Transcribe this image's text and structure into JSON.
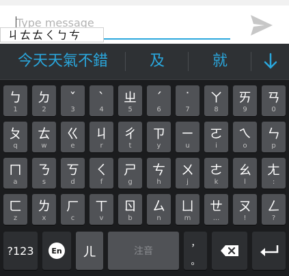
{
  "compose": {
    "placeholder": "Type message",
    "composing_text": "ㄐㄊㄊㄑㄅㄘ",
    "send_icon": "send-icon"
  },
  "candidates": {
    "items": [
      "今天天氣不錯",
      "及",
      "就"
    ],
    "more_icon": "chevron-down-icon"
  },
  "keyboard": {
    "rows": [
      [
        {
          "main": "ㄅ",
          "sub": "1"
        },
        {
          "main": "ㄉ",
          "sub": "2"
        },
        {
          "main": "ˇ",
          "sub": "3"
        },
        {
          "main": "ˋ",
          "sub": "4"
        },
        {
          "main": "ㄓ",
          "sub": "5"
        },
        {
          "main": "ˊ",
          "sub": "6"
        },
        {
          "main": "˙",
          "sub": "7"
        },
        {
          "main": "ㄚ",
          "sub": "8"
        },
        {
          "main": "ㄞ",
          "sub": "9"
        },
        {
          "main": "ㄢ",
          "sub": "0"
        }
      ],
      [
        {
          "main": "ㄆ",
          "sub": "q"
        },
        {
          "main": "ㄊ",
          "sub": "w"
        },
        {
          "main": "ㄍ",
          "sub": "e"
        },
        {
          "main": "ㄐ",
          "sub": "r"
        },
        {
          "main": "ㄔ",
          "sub": "t"
        },
        {
          "main": "ㄗ",
          "sub": "y"
        },
        {
          "main": "ㄧ",
          "sub": "u"
        },
        {
          "main": "ㄛ",
          "sub": "i"
        },
        {
          "main": "ㄟ",
          "sub": "o"
        },
        {
          "main": "ㄣ",
          "sub": "p"
        }
      ],
      [
        {
          "main": "ㄇ",
          "sub": "a"
        },
        {
          "main": "ㄋ",
          "sub": "s"
        },
        {
          "main": "ㄎ",
          "sub": "d"
        },
        {
          "main": "ㄑ",
          "sub": "f"
        },
        {
          "main": "ㄕ",
          "sub": "g"
        },
        {
          "main": "ㄘ",
          "sub": "h"
        },
        {
          "main": "ㄨ",
          "sub": "j"
        },
        {
          "main": "ㄜ",
          "sub": "k"
        },
        {
          "main": "ㄠ",
          "sub": "l"
        },
        {
          "main": "ㄤ",
          "sub": ":"
        }
      ],
      [
        {
          "main": "ㄈ",
          "sub": "z"
        },
        {
          "main": "ㄌ",
          "sub": "x"
        },
        {
          "main": "ㄏ",
          "sub": "c"
        },
        {
          "main": "ㄒ",
          "sub": "v"
        },
        {
          "main": "ㄖ",
          "sub": "b"
        },
        {
          "main": "ㄙ",
          "sub": "n"
        },
        {
          "main": "ㄩ",
          "sub": "m"
        },
        {
          "main": "ㄝ",
          "sub": "..."
        },
        {
          "main": "ㄡ",
          "sub": "!"
        },
        {
          "main": "ㄥ",
          "sub": "?"
        }
      ]
    ],
    "bottom": {
      "symbols_label": "?123",
      "lang_label": "En",
      "er_label": "ㄦ",
      "space_label": "注音",
      "punct_top": "，",
      "punct_bottom": "。",
      "backspace_icon": "backspace-icon",
      "enter_icon": "enter-icon"
    }
  },
  "colors": {
    "accent": "#2aa7dd",
    "key": "#505256",
    "key_dark": "#2d2f32",
    "keyboard_bg": "#1b1c1e"
  }
}
